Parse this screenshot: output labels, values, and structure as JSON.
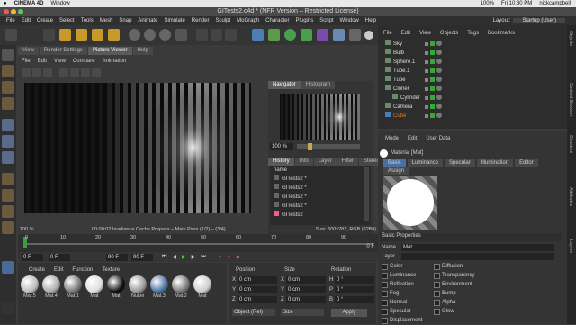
{
  "menubar": {
    "app": "CINEMA 4D",
    "window": "Window",
    "status": "100%",
    "time": "Fri 10:30 PM",
    "user": "nickcampbell"
  },
  "title": "GITests2.c4d * (NFR Version – Restricted License)",
  "appmenu": [
    "File",
    "Edit",
    "Create",
    "Select",
    "Tools",
    "Mesh",
    "Snap",
    "Animate",
    "Simulate",
    "Render",
    "Sculpt",
    "MoGraph",
    "Character",
    "Plugins",
    "Script",
    "Window",
    "Help"
  ],
  "layout": {
    "label": "Layout:",
    "value": "Startup (User)"
  },
  "picture_viewer": {
    "tabs": [
      "View",
      "Render Settings",
      "Picture Viewer",
      "Help"
    ],
    "submenu": [
      "File",
      "Edit",
      "View",
      "Compare",
      "Animation"
    ],
    "nav_tabs": [
      "Navigator",
      "Histogram"
    ],
    "zoom": "100 %",
    "info_tabs": [
      "History",
      "Info",
      "Layer",
      "Filter",
      "Stereo"
    ],
    "history_header": "name",
    "history_items": [
      "GITests2 *",
      "GITests2 *",
      "GITests2 *",
      "GITests2 *",
      "GITests2"
    ],
    "status_zoom": "100 %",
    "status_text": "00:00:02 Irradiance Cache Prepass – Main Pass (1/2) – (3/4)",
    "status_size": "Size: 500x281, RGB (32Bit)"
  },
  "timeline": {
    "ticks": [
      "0",
      "10",
      "20",
      "30",
      "40",
      "50",
      "60",
      "70",
      "80",
      "90"
    ],
    "frame_label": "0 F"
  },
  "playback": {
    "start": "0 F",
    "current": "0 F",
    "end": "90 F",
    "end2": "90 F"
  },
  "material_manager": {
    "menu": [
      "Create",
      "Edit",
      "Function",
      "Texture"
    ],
    "materials": [
      "Mat.5",
      "Mat.4",
      "Mat.1",
      "Mat",
      "Mat",
      "Nukei",
      "Mat.3",
      "Mat.2",
      "Mat"
    ]
  },
  "coords": {
    "headers": [
      "Position",
      "Size",
      "Rotation"
    ],
    "rows": [
      {
        "axis": "X",
        "pos": "0 cm",
        "size": "0 cm",
        "rot_label": "H",
        "rot": "0 °"
      },
      {
        "axis": "Y",
        "pos": "0 cm",
        "size": "0 cm",
        "rot_label": "P",
        "rot": "0 °"
      },
      {
        "axis": "Z",
        "pos": "0 cm",
        "size": "0 cm",
        "rot_label": "B",
        "rot": "0 °"
      }
    ],
    "mode": "Object (Rel)",
    "size_mode": "Size",
    "apply": "Apply"
  },
  "object_manager": {
    "menu": [
      "File",
      "Edit",
      "View",
      "Objects",
      "Tags",
      "Bookmarks"
    ],
    "objects": [
      "Sky",
      "Bulb",
      "Sphere.1",
      "Tube.1",
      "Tube",
      "Cloner",
      "Cylinder",
      "Camera",
      "Cube"
    ]
  },
  "attributes": {
    "menu": [
      "Mode",
      "Edit",
      "User Data"
    ],
    "title": "Material [Mat]",
    "tabs": [
      "Basic",
      "Luminance",
      "Specular",
      "Illumination",
      "Editor",
      "Assign"
    ],
    "section": "Basic Properties",
    "name_label": "Name",
    "name_value": "Mat",
    "layer_label": "Layer",
    "channels_left": [
      "Color",
      "Luminance",
      "Reflection",
      "Fog",
      "Normal",
      "Specular",
      "Displacement"
    ],
    "channels_right": [
      "Diffusion",
      "Transparency",
      "Environment",
      "Bump",
      "Alpha",
      "Glow"
    ]
  },
  "side_tabs": [
    "Objects",
    "Content Browser",
    "Structure",
    "Attributes",
    "Layers"
  ],
  "colors": {
    "accent": "#e07a1f",
    "viewport_bg": "#0b0b0b",
    "panel": "#343434",
    "highlight": "#f05a9a"
  }
}
